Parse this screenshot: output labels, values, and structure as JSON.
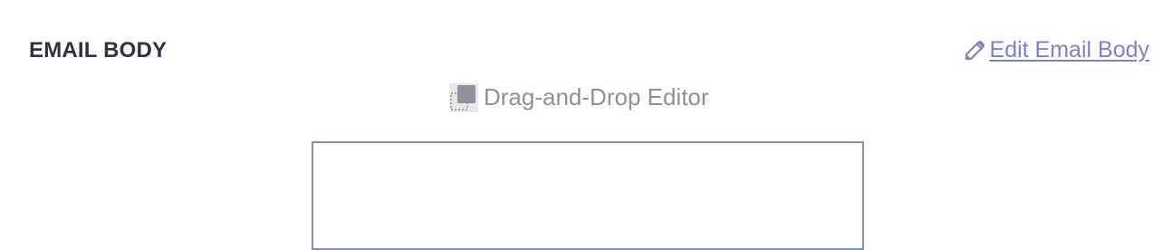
{
  "section": {
    "title": "EMAIL BODY"
  },
  "edit": {
    "label": " Edit Email Body",
    "icon": "pencil-icon",
    "color": "#7a84c4"
  },
  "editor": {
    "label": "Drag-and-Drop Editor",
    "icon": "drag-and-drop-icon"
  },
  "colors": {
    "title": "#2b3540",
    "muted": "#8b929a",
    "frame_border": "#8088c6"
  }
}
